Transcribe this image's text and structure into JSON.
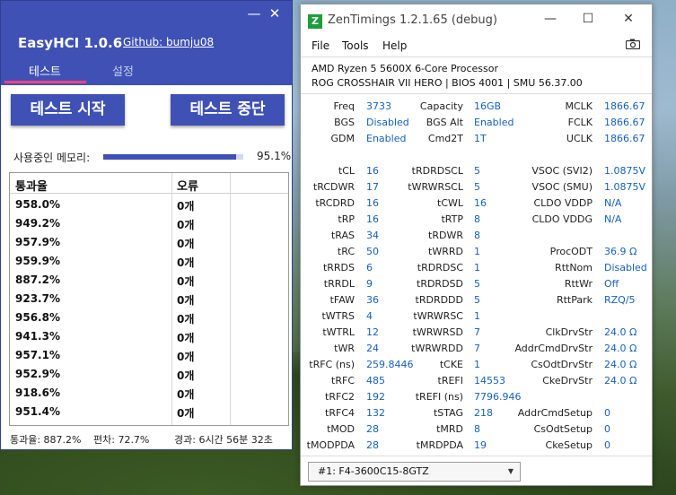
{
  "easyhci": {
    "title": "EasyHCI 1.0.6",
    "github_link": "Github: bumju08",
    "window_controls": {
      "minimize": "—",
      "close": "✕"
    },
    "tabs": [
      {
        "label": "테스트",
        "active": true
      },
      {
        "label": "설정",
        "active": false
      }
    ],
    "buttons": {
      "start": "테스트 시작",
      "stop": "테스트 중단"
    },
    "memory": {
      "label": "사용중인 메모리:",
      "percent_text": "95.1%",
      "fill_fraction": 0.951
    },
    "table": {
      "headers": [
        "통과율",
        "오류"
      ],
      "rows": [
        {
          "pass": "958.0%",
          "errors": "0개"
        },
        {
          "pass": "949.2%",
          "errors": "0개"
        },
        {
          "pass": "957.9%",
          "errors": "0개"
        },
        {
          "pass": "959.9%",
          "errors": "0개"
        },
        {
          "pass": "887.2%",
          "errors": "0개"
        },
        {
          "pass": "923.7%",
          "errors": "0개"
        },
        {
          "pass": "956.8%",
          "errors": "0개"
        },
        {
          "pass": "941.3%",
          "errors": "0개"
        },
        {
          "pass": "957.1%",
          "errors": "0개"
        },
        {
          "pass": "952.9%",
          "errors": "0개"
        },
        {
          "pass": "918.6%",
          "errors": "0개"
        },
        {
          "pass": "951.4%",
          "errors": "0개"
        }
      ]
    },
    "status": {
      "pass_rate": "통과율: 887.2%",
      "deviation": "편차: 72.7%",
      "elapsed": "경과: 6시간 56분 32초"
    },
    "colors": {
      "primary": "#3f51b5",
      "accent": "#ff4081"
    }
  },
  "zentimings": {
    "icon_letter": "Z",
    "title": "ZenTimings 1.2.1.65 (debug)",
    "window_controls": {
      "minimize": "—",
      "maximize": "☐",
      "close": "✕"
    },
    "menu": [
      "File",
      "Tools",
      "Help"
    ],
    "cpu": "AMD Ryzen 5 5600X 6-Core Processor",
    "board": "ROG CROSSHAIR VII HERO | BIOS 4001 | SMU 56.37.00",
    "top_rows": [
      [
        {
          "label": "Freq",
          "value": "3733"
        },
        {
          "label": "Capacity",
          "value": "16GB"
        },
        {
          "label": "MCLK",
          "value": "1866.67"
        }
      ],
      [
        {
          "label": "BGS",
          "value": "Disabled"
        },
        {
          "label": "BGS Alt",
          "value": "Enabled"
        },
        {
          "label": "FCLK",
          "value": "1866.67"
        }
      ],
      [
        {
          "label": "GDM",
          "value": "Enabled"
        },
        {
          "label": "Cmd2T",
          "value": "1T"
        },
        {
          "label": "UCLK",
          "value": "1866.67"
        }
      ]
    ],
    "timing_rows": [
      [
        {
          "label": "tCL",
          "value": "16"
        },
        {
          "label": "tRDRDSCL",
          "value": "5"
        },
        {
          "label": "VSOC (SVI2)",
          "value": "1.0875V"
        }
      ],
      [
        {
          "label": "tRCDWR",
          "value": "17"
        },
        {
          "label": "tWRWRSCL",
          "value": "5"
        },
        {
          "label": "VSOC (SMU)",
          "value": "1.0875V"
        }
      ],
      [
        {
          "label": "tRCDRD",
          "value": "16"
        },
        {
          "label": "tCWL",
          "value": "16"
        },
        {
          "label": "CLDO VDDP",
          "value": "N/A"
        }
      ],
      [
        {
          "label": "tRP",
          "value": "16"
        },
        {
          "label": "tRTP",
          "value": "8"
        },
        {
          "label": "CLDO VDDG",
          "value": "N/A"
        }
      ],
      [
        {
          "label": "tRAS",
          "value": "34"
        },
        {
          "label": "tRDWR",
          "value": "8"
        },
        {
          "label": "",
          "value": ""
        }
      ],
      [
        {
          "label": "tRC",
          "value": "50"
        },
        {
          "label": "tWRRD",
          "value": "1"
        },
        {
          "label": "ProcODT",
          "value": "36.9 Ω"
        }
      ],
      [
        {
          "label": "tRRDS",
          "value": "6"
        },
        {
          "label": "tRDRDSC",
          "value": "1"
        },
        {
          "label": "RttNom",
          "value": "Disabled"
        }
      ],
      [
        {
          "label": "tRRDL",
          "value": "9"
        },
        {
          "label": "tRDRDSD",
          "value": "5"
        },
        {
          "label": "RttWr",
          "value": "Off"
        }
      ],
      [
        {
          "label": "tFAW",
          "value": "36"
        },
        {
          "label": "tRDRDDD",
          "value": "5"
        },
        {
          "label": "RttPark",
          "value": "RZQ/5"
        }
      ],
      [
        {
          "label": "tWTRS",
          "value": "4"
        },
        {
          "label": "tWRWRSC",
          "value": "1"
        },
        {
          "label": "",
          "value": ""
        }
      ],
      [
        {
          "label": "tWTRL",
          "value": "12"
        },
        {
          "label": "tWRWRSD",
          "value": "7"
        },
        {
          "label": "ClkDrvStr",
          "value": "24.0 Ω"
        }
      ],
      [
        {
          "label": "tWR",
          "value": "24"
        },
        {
          "label": "tWRWRDD",
          "value": "7"
        },
        {
          "label": "AddrCmdDrvStr",
          "value": "24.0 Ω"
        }
      ],
      [
        {
          "label": "tRFC (ns)",
          "value": "259.8446"
        },
        {
          "label": "tCKE",
          "value": "1"
        },
        {
          "label": "CsOdtDrvStr",
          "value": "24.0 Ω"
        }
      ],
      [
        {
          "label": "tRFC",
          "value": "485"
        },
        {
          "label": "tREFI",
          "value": "14553"
        },
        {
          "label": "CkeDrvStr",
          "value": "24.0 Ω"
        }
      ],
      [
        {
          "label": "tRFC2",
          "value": "192"
        },
        {
          "label": "tREFI (ns)",
          "value": "7796.946"
        },
        {
          "label": "",
          "value": ""
        }
      ],
      [
        {
          "label": "tRFC4",
          "value": "132"
        },
        {
          "label": "tSTAG",
          "value": "218"
        },
        {
          "label": "AddrCmdSetup",
          "value": "0"
        }
      ],
      [
        {
          "label": "tMOD",
          "value": "28"
        },
        {
          "label": "tMRD",
          "value": "8"
        },
        {
          "label": "CsOdtSetup",
          "value": "0"
        }
      ],
      [
        {
          "label": "tMODPDA",
          "value": "28"
        },
        {
          "label": "tMRDPDA",
          "value": "19"
        },
        {
          "label": "CkeSetup",
          "value": "0"
        }
      ]
    ],
    "module_select": "#1: F4-3600C15-8GTZ",
    "colors": {
      "value_text": "#1560bd",
      "icon": "#1e9e3a"
    }
  }
}
